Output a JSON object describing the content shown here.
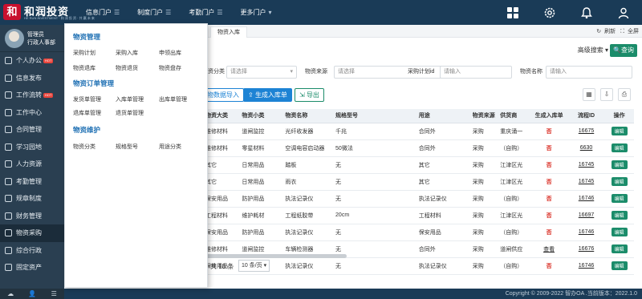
{
  "app": {
    "logo_text": "和润投资",
    "logo_mark": "和",
    "logo_sub": "HE RUN INVESTMENT · 和 润 投 资 · 共 赢 未 来"
  },
  "topnav": [
    {
      "label": "信息门户",
      "glyph": "☰"
    },
    {
      "label": "制度门户",
      "glyph": "☰"
    },
    {
      "label": "考勤门户",
      "glyph": "☰"
    },
    {
      "label": "更多门户",
      "glyph": "▾"
    }
  ],
  "top_icons": [
    "apps-grid-icon",
    "settings-gear-icon",
    "notification-bell-icon",
    "user-profile-icon"
  ],
  "user": {
    "name": "管理员",
    "role": "行政人事部"
  },
  "sidebar": {
    "items": [
      {
        "label": "个人办公",
        "hot": "HOT"
      },
      {
        "label": "信息发布",
        "hot": ""
      },
      {
        "label": "工作流转",
        "hot": "HOT"
      },
      {
        "label": "工作中心",
        "hot": ""
      },
      {
        "label": "合同管理",
        "hot": ""
      },
      {
        "label": "学习园地",
        "hot": ""
      },
      {
        "label": "人力资源",
        "hot": ""
      },
      {
        "label": "考勤管理",
        "hot": ""
      },
      {
        "label": "规章制度",
        "hot": ""
      },
      {
        "label": "财务管理",
        "hot": ""
      },
      {
        "label": "物资采购",
        "hot": ""
      },
      {
        "label": "综合行政",
        "hot": ""
      },
      {
        "label": "固定资产",
        "hot": ""
      }
    ],
    "bottom_icons": [
      "cloud-upload-icon",
      "person-icon",
      "menu-list-icon"
    ]
  },
  "tabs": {
    "active": "物资入库",
    "refresh": "刷新",
    "fullscreen": "全屏"
  },
  "filters": {
    "adv_search": "高级搜索",
    "query_label": "查询",
    "category_label": "物资分类",
    "category_value": "请选择",
    "source_label": "物资来源",
    "source_value": "请选择",
    "plan_id_label": "采购计划id",
    "plan_id_placeholder": "请输入",
    "name_label": "物资名称",
    "name_placeholder": "请输入"
  },
  "actions": {
    "import": "物数据导入",
    "generate": "生成入库单",
    "export": "导出"
  },
  "table": {
    "columns": [
      "物资大类",
      "物资小类",
      "物资名称",
      "规格型号",
      "用途",
      "物资来源",
      "供货商",
      "生成入库单",
      "流程ID",
      "操作"
    ],
    "rows": [
      [
        "维修材料",
        "道闸监控",
        "光纤收发器",
        "千兆",
        "合同外",
        "采购",
        "重庆涌一",
        "否",
        "16675",
        "编辑"
      ],
      [
        "维修材料",
        "零星材料",
        "空调电容启动器",
        "50微法",
        "合同外",
        "采购",
        "（自购）",
        "否",
        "6630",
        "编辑"
      ],
      [
        "其它",
        "日常用品",
        "踏板",
        "无",
        "其它",
        "采购",
        "江津区光",
        "否",
        "16745",
        "编辑"
      ],
      [
        "其它",
        "日常用品",
        "雨衣",
        "无",
        "其它",
        "采购",
        "江津区光",
        "否",
        "16745",
        "编辑"
      ],
      [
        "保安用品",
        "防护用品",
        "执法记录仪",
        "无",
        "执法记录仪",
        "采购",
        "（自购）",
        "否",
        "16746",
        "编辑"
      ],
      [
        "工程材料",
        "维护耗材",
        "工程纸胶带",
        "20cm",
        "工程材料",
        "采购",
        "江津区光",
        "否",
        "16697",
        "编辑"
      ],
      [
        "保安用品",
        "防护用品",
        "执法记录仪",
        "无",
        "保安用品",
        "采购",
        "（自购）",
        "否",
        "16746",
        "编辑"
      ],
      [
        "维修材料",
        "道闸监控",
        "车辆检测器",
        "无",
        "合同外",
        "采购",
        "道闸供应",
        "查看",
        "16676",
        "编辑"
      ],
      [
        "保安用品",
        "防护用品",
        "执法记录仪",
        "无",
        "执法记录仪",
        "采购",
        "（自购）",
        "否",
        "16746",
        "编辑"
      ]
    ]
  },
  "pager": {
    "total": "共 18 条",
    "page_size": "10 条/页"
  },
  "footer": "Copyright © 2009-2022 智办OA .当前版本：2022.1.0",
  "dropdown": {
    "sections": [
      {
        "title": "物资管理",
        "links": [
          "采购计划",
          "采购入库",
          "申领出库",
          "物资退库",
          "物资退货",
          "物资盘存"
        ]
      },
      {
        "title": "物资订单管理",
        "links": [
          "发货单管理",
          "入库单管理",
          "出库单管理",
          "退库单管理",
          "退货单管理"
        ]
      },
      {
        "title": "物资维护",
        "links": [
          "物资分类",
          "规格型号",
          "用途分类"
        ]
      }
    ]
  }
}
